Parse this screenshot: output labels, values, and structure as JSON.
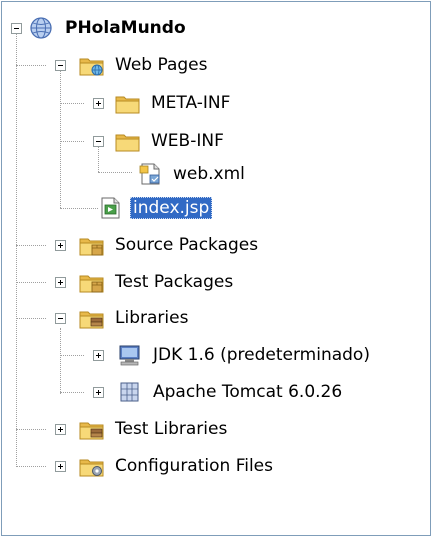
{
  "tree": {
    "root": {
      "label": "PHolaMundo"
    },
    "web_pages": {
      "label": "Web Pages"
    },
    "meta_inf": {
      "label": "META-INF"
    },
    "web_inf": {
      "label": "WEB-INF"
    },
    "web_xml": {
      "label": "web.xml"
    },
    "index_jsp": {
      "label": "index.jsp"
    },
    "source_packages": {
      "label": "Source Packages"
    },
    "test_packages": {
      "label": "Test Packages"
    },
    "libraries": {
      "label": "Libraries"
    },
    "jdk": {
      "label": "JDK 1.6 (predeterminado)"
    },
    "tomcat": {
      "label": "Apache Tomcat 6.0.26"
    },
    "test_libraries": {
      "label": "Test Libraries"
    },
    "config_files": {
      "label": "Configuration Files"
    }
  },
  "colors": {
    "selection": "#316ac5",
    "folder": "#f2cf5b",
    "border": "#7f9db9"
  }
}
